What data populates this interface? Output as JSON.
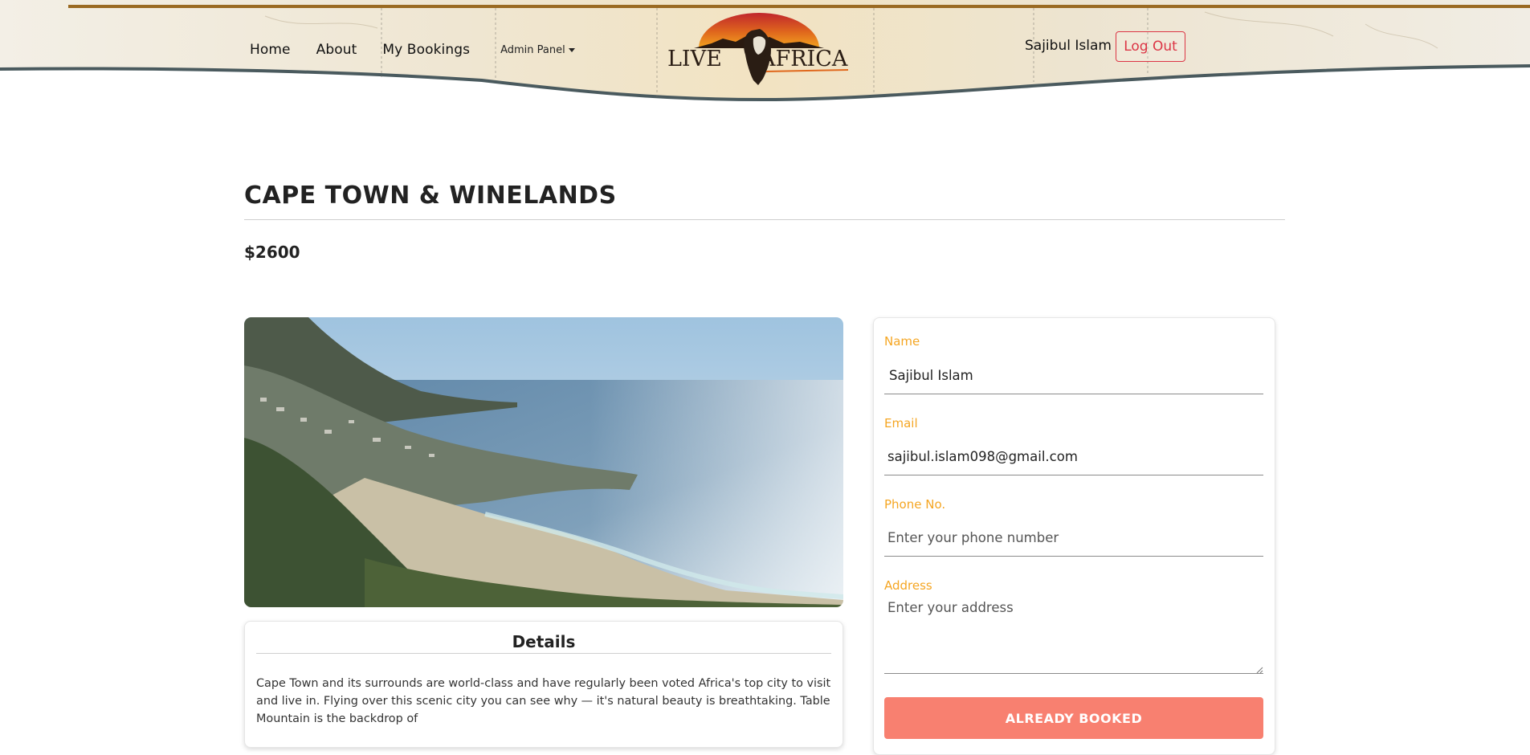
{
  "header": {
    "nav": {
      "home": "Home",
      "about": "About",
      "my_bookings": "My Bookings",
      "admin_panel": "Admin Panel"
    },
    "logo_text": "LIVE AFRICA",
    "user_name": "Sajibul Islam",
    "logout_label": "Log Out"
  },
  "tour": {
    "title": "CAPE TOWN & WINELANDS",
    "price": "$2600",
    "image_alt": "coastline-photo",
    "details_heading": "Details",
    "details_text": "Cape Town and its surrounds are world-class and have regularly been voted Africa's top city to visit and live in. Flying over this scenic city you can see why — it's natural beauty is breathtaking. Table Mountain is the backdrop of"
  },
  "form": {
    "name_label": "Name",
    "name_value": "Sajibul Islam",
    "email_label": "Email",
    "email_value": "sajibul.islam098@gmail.com",
    "phone_label": "Phone No.",
    "phone_placeholder": "Enter your phone number",
    "address_label": "Address",
    "address_placeholder": "Enter your address",
    "submit_label": "ALREADY BOOKED"
  },
  "colors": {
    "accent_label": "#f5a623",
    "button_bg": "#f88070",
    "logout": "#dc3545"
  }
}
